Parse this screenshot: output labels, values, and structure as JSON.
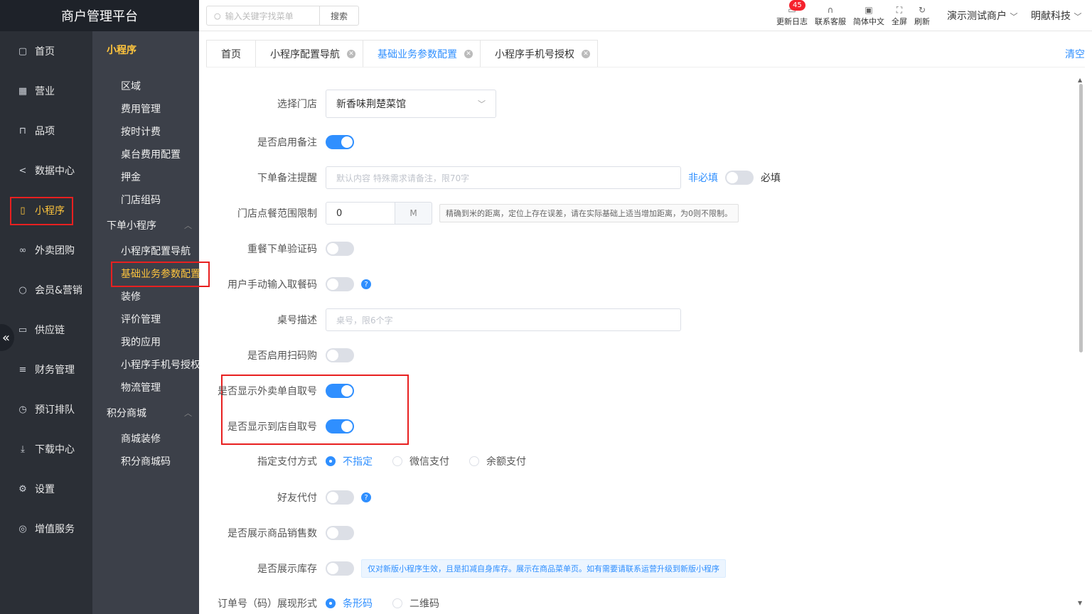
{
  "app": {
    "title": "商户管理平台"
  },
  "sidebar": {
    "items": [
      {
        "label": "首页",
        "icon": "home-icon"
      },
      {
        "label": "营业",
        "icon": "calendar-icon"
      },
      {
        "label": "品项",
        "icon": "bag-icon"
      },
      {
        "label": "数据中心",
        "icon": "share-icon"
      },
      {
        "label": "小程序",
        "icon": "phone-icon",
        "active": true
      },
      {
        "label": "外卖团购",
        "icon": "bike-icon"
      },
      {
        "label": "会员&营销",
        "icon": "user-icon"
      },
      {
        "label": "供应链",
        "icon": "truck-icon"
      },
      {
        "label": "财务管理",
        "icon": "database-icon"
      },
      {
        "label": "预订排队",
        "icon": "clock-icon"
      },
      {
        "label": "下载中心",
        "icon": "download-icon"
      },
      {
        "label": "设置",
        "icon": "gear-icon"
      },
      {
        "label": "增值服务",
        "icon": "alarm-icon"
      }
    ]
  },
  "submenu": {
    "title": "小程序",
    "group1": [
      "区域",
      "费用管理",
      "按时计费",
      "桌台费用配置",
      "押金",
      "门店组码"
    ],
    "group2_title": "下单小程序",
    "group2": [
      "小程序配置导航",
      "基础业务参数配置",
      "装修",
      "评价管理",
      "我的应用",
      "小程序手机号授权",
      "物流管理"
    ],
    "group3_title": "积分商城",
    "group3": [
      "商城装修",
      "积分商城码"
    ]
  },
  "topbar": {
    "search_placeholder": "输入关键字找菜单",
    "search_button": "搜索",
    "tools": [
      {
        "label": "更新日志",
        "icon": "log-icon",
        "badge": "45"
      },
      {
        "label": "联系客服",
        "icon": "headset-icon"
      },
      {
        "label": "简体中文",
        "icon": "language-icon"
      },
      {
        "label": "全屏",
        "icon": "fullscreen-icon"
      },
      {
        "label": "刷新",
        "icon": "refresh-icon"
      }
    ],
    "merchant": "演示测试商户",
    "company": "明献科技"
  },
  "tabs": [
    {
      "label": "首页",
      "closable": false
    },
    {
      "label": "小程序配置导航",
      "closable": true
    },
    {
      "label": "基础业务参数配置",
      "closable": true,
      "active": true
    },
    {
      "label": "小程序手机号授权",
      "closable": true
    }
  ],
  "clear_label": "清空",
  "form": {
    "store": {
      "label": "选择门店",
      "value": "新香味荆楚菜馆"
    },
    "enable_remark": {
      "label": "是否启用备注",
      "on": true
    },
    "remark_reminder": {
      "label": "下单备注提醒",
      "placeholder": "默认内容 特殊需求请备注，限70字",
      "optional": "非必填",
      "required": "必填"
    },
    "range_limit": {
      "label": "门店点餐范围限制",
      "value": "0",
      "unit": "M",
      "hint": "精确到米的距离，定位上存在误差，请在实际基础上适当增加距离，为0则不限制。"
    },
    "reorder_code": {
      "label": "重餐下单验证码",
      "on": false
    },
    "manual_pickup": {
      "label": "用户手动输入取餐码",
      "on": false
    },
    "table_desc": {
      "label": "桌号描述",
      "placeholder": "桌号，限6个字"
    },
    "scan_buy": {
      "label": "是否启用扫码购",
      "on": false
    },
    "show_takeout_pickup": {
      "label": "是否显示外卖单自取号",
      "on": true
    },
    "show_instore_pickup": {
      "label": "是否显示到店自取号",
      "on": true
    },
    "payment": {
      "label": "指定支付方式",
      "options": [
        "不指定",
        "微信支付",
        "余额支付"
      ],
      "selected": "不指定"
    },
    "friend_pay": {
      "label": "好友代付",
      "on": false
    },
    "show_sales": {
      "label": "是否展示商品销售数",
      "on": false
    },
    "show_stock": {
      "label": "是否展示库存",
      "on": false,
      "hint": "仅对新版小程序生效，且是扣减自身库存。展示在商品菜单页。如有需要请联系运营升级到新版小程序"
    },
    "order_format": {
      "label": "订单号（码）展现形式",
      "options": [
        "条形码",
        "二维码"
      ],
      "selected": "条形码"
    }
  }
}
